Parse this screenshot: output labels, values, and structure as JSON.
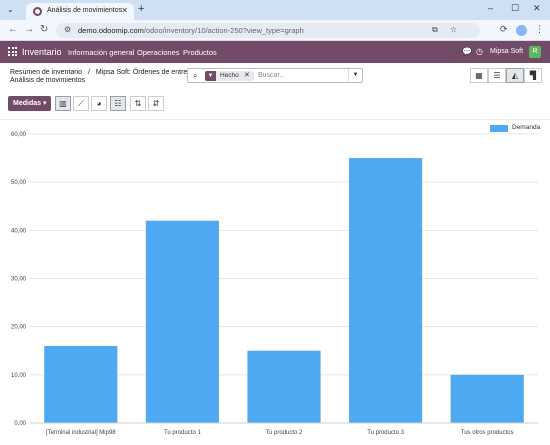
{
  "browser": {
    "tab_title": "Análisis de movimientos",
    "url_host": "demo.odoomip.com",
    "url_path": "/odoo/inventory/10/action-250?view_type=graph"
  },
  "navbar": {
    "app_name": "Inventario",
    "menu": [
      "Información general",
      "Operaciones",
      "Productos"
    ],
    "company": "Mipsa Soft",
    "avatar_letter": "R",
    "color": "#714b67"
  },
  "control": {
    "breadcrumb_1": "Resumen de inventario",
    "breadcrumb_sep": "/",
    "breadcrumb_2": "Mipsa Soft: Órdenes de entrega",
    "current": "Análisis de movimientos",
    "facet_label": "Hecho",
    "search_placeholder": "Buscar...",
    "measures_label": "Medidas"
  },
  "chart_data": {
    "type": "bar",
    "categories": [
      "[Terminal industrial] Mip98",
      "Tu producto 1",
      "Tu producto 2",
      "Tu producto 3",
      "Tus otros productos"
    ],
    "series": [
      {
        "name": "Demanda",
        "values": [
          16,
          42,
          15,
          55,
          10
        ],
        "color": "#4ea8f2"
      }
    ],
    "ylim": [
      0,
      60
    ],
    "yticks": [
      "0,00",
      "10,00",
      "20,00",
      "30,00",
      "40,00",
      "50,00",
      "60,00"
    ],
    "legend": "top-right",
    "grid": true
  }
}
